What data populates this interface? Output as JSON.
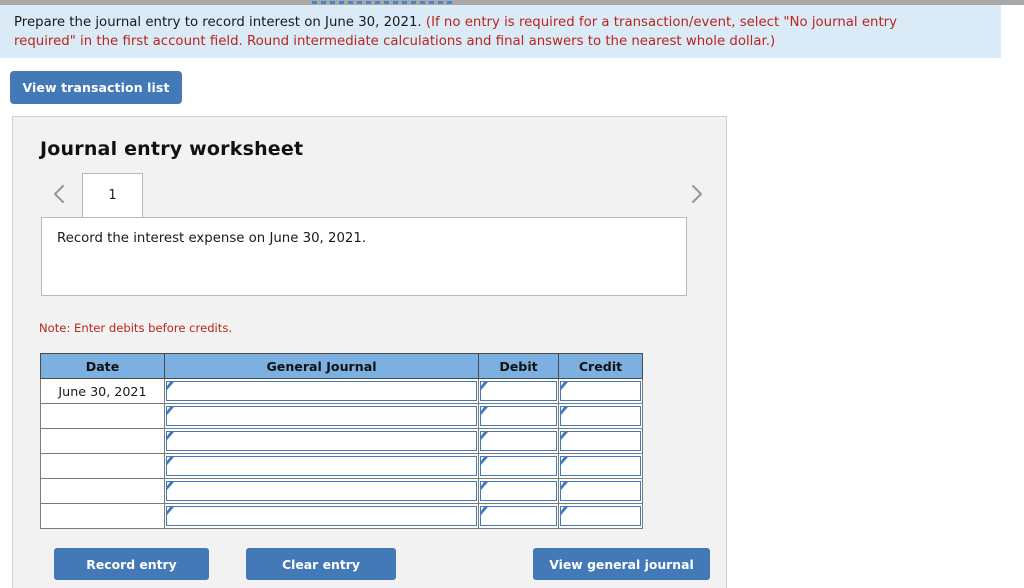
{
  "colors": {
    "accent_blue": "#4279b6",
    "header_blue": "#7cb0e0",
    "banner_bg": "#dbeaf7",
    "panel_bg": "#f2f2f2",
    "note_red": "#b8261c"
  },
  "top_handle": {
    "icon": "horizontal-dashed-handle"
  },
  "instruction": {
    "black_text": "Prepare the journal entry to record interest on June 30, 2021.",
    "red_text_line1": "(If no entry is required for a transaction/event, select \"No journal entry",
    "red_text_line2": "required\" in the first account field. Round intermediate calculations and final answers to the nearest whole dollar.)"
  },
  "toolbar": {
    "view_transaction_list_label": "View transaction list"
  },
  "worksheet": {
    "title": "Journal entry worksheet",
    "prev_icon": "chevron-left-icon",
    "next_icon": "chevron-right-icon",
    "tabs": [
      {
        "label": "1",
        "active": true
      }
    ],
    "task_text": "Record the interest expense on June 30, 2021.",
    "note": "Note: Enter debits before credits."
  },
  "journal_table": {
    "headers": [
      "Date",
      "General Journal",
      "Debit",
      "Credit"
    ],
    "rows": [
      {
        "date": "June 30, 2021",
        "general_journal": "",
        "debit": "",
        "credit": ""
      },
      {
        "date": "",
        "general_journal": "",
        "debit": "",
        "credit": ""
      },
      {
        "date": "",
        "general_journal": "",
        "debit": "",
        "credit": ""
      },
      {
        "date": "",
        "general_journal": "",
        "debit": "",
        "credit": ""
      },
      {
        "date": "",
        "general_journal": "",
        "debit": "",
        "credit": ""
      },
      {
        "date": "",
        "general_journal": "",
        "debit": "",
        "credit": ""
      }
    ]
  },
  "footer_buttons": {
    "record_entry": "Record entry",
    "clear_entry": "Clear entry",
    "view_general_journal": "View general journal"
  }
}
